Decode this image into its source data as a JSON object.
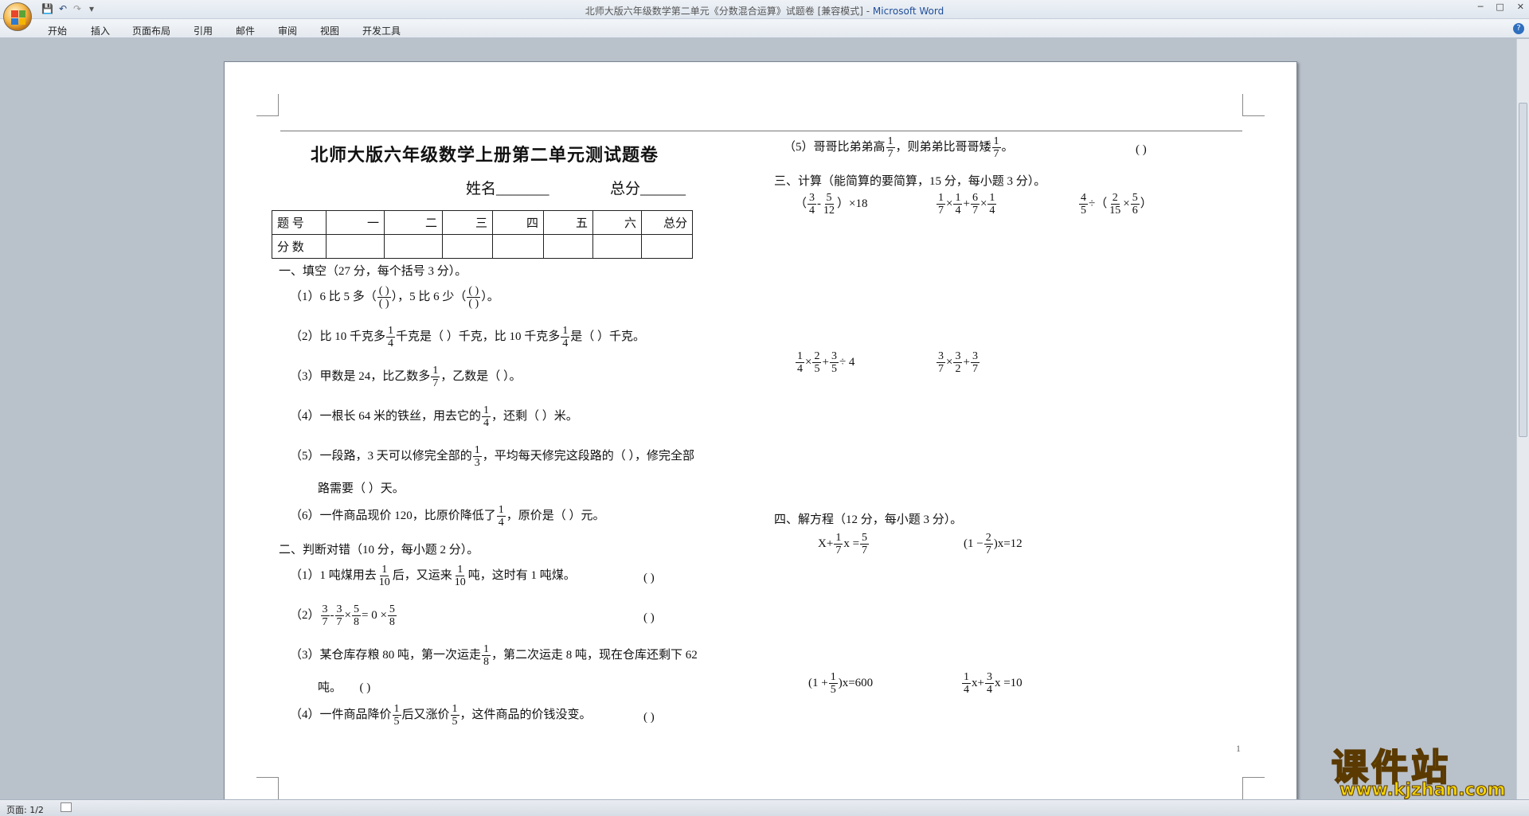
{
  "window": {
    "title_doc": "北师大版六年级数学第二单元《分数混合运算》试题卷 [兼容模式] - ",
    "title_app": "Microsoft Word",
    "minimize": "─",
    "maximize": "□",
    "close": "✕"
  },
  "quick_access": {
    "save_icon": "save-icon",
    "undo_icon": "undo-icon",
    "redo_icon": "redo-icon",
    "more": "▾"
  },
  "ribbon_tabs": [
    "开始",
    "插入",
    "页面布局",
    "引用",
    "邮件",
    "审阅",
    "视图",
    "开发工具"
  ],
  "status": {
    "page": "页面: 1/2"
  },
  "watermark": {
    "line1": "课件站",
    "line2": "www.kjzhan.com"
  },
  "doc": {
    "title": "北师大版六年级数学上册第二单元测试题卷",
    "name_label": "姓名_______",
    "score_label": "总分______",
    "table": {
      "row1": [
        "题 号",
        "一",
        "二",
        "三",
        "四",
        "五",
        "六",
        "总分"
      ],
      "row2": [
        "分 数",
        "",
        "",
        "",
        "",
        "",
        "",
        ""
      ]
    },
    "sec1": "一、填空（27 分，每个括号 3 分）。",
    "q1_1a": "（1）6 比 5 多（",
    "q1_1b": "），5 比 6 少（",
    "q1_1c": "）。",
    "paren": "( )",
    "q1_2a": "（2）比 10 千克多",
    "q1_2b": "千克是（    ）千克，比 10 千克多",
    "q1_2c": "是（    ）千克。",
    "q1_3a": "（3）甲数是 24，比乙数多",
    "q1_3b": "，乙数是（   ）。",
    "q1_4a": "（4）一根长 64 米的铁丝，用去它的",
    "q1_4b": "，还剩（   ）米。",
    "q1_5a": "（5）一段路，3 天可以修完全部的",
    "q1_5b": "，平均每天修完这段路的（    ），修完全部",
    "q1_5c": "路需要（   ）天。",
    "q1_6a": "（6）一件商品现价 120，比原价降低了",
    "q1_6b": "，原价是（   ）元。",
    "sec2": "二、判断对错（10 分，每小题 2 分）。",
    "q2_1a": "（1）1 吨煤用去",
    "q2_1b": "后，又运来",
    "q2_1c": "吨，这时有 1 吨煤。",
    "blank": "(      )",
    "q2_2a": "（2）",
    "q2_3a": "（3）某仓库存粮 80 吨，第一次运走",
    "q2_3b": "，第二次运走 8 吨，现在仓库还剩下 62",
    "q2_3c": "吨。",
    "q2_4a": "（4）一件商品降价",
    "q2_4b": "后又涨价",
    "q2_4c": "，这件商品的价钱没变。",
    "q1_r5a": "（5）哥哥比弟弟高",
    "q1_r5b": "，则弟弟比哥哥矮",
    "q1_r5c": "。",
    "sec3": "三、计算（能简算的要简算，15 分，每小题 3 分）。",
    "sec4": "四、解方程（12 分，每小题 3 分）。",
    "page_number": "1",
    "fracs": {
      "n1": "1",
      "n2": "2",
      "n3": "3",
      "n4": "4",
      "n5": "5",
      "n6": "6",
      "d3": "3",
      "d4": "4",
      "d5": "5",
      "d6": "6",
      "d7": "7",
      "d8": "8",
      "d10": "10",
      "d12": "12",
      "d15": "15"
    },
    "ops": {
      "times18": "）×18",
      "minus": "-",
      "x": "×",
      "plus": "+",
      "div": "÷",
      "lparen": "（",
      "rparen": "）",
      "div4": "÷ 4",
      "eq0": "= 0 ×",
      "X": "X",
      "xeq": "x =",
      "one_minus": "(1 −",
      "xeq12": ")x=12",
      "one_plus": "(1 +",
      "xeq600": ")x=600",
      "xi": "x",
      "xi_eq10": "x =10"
    }
  }
}
